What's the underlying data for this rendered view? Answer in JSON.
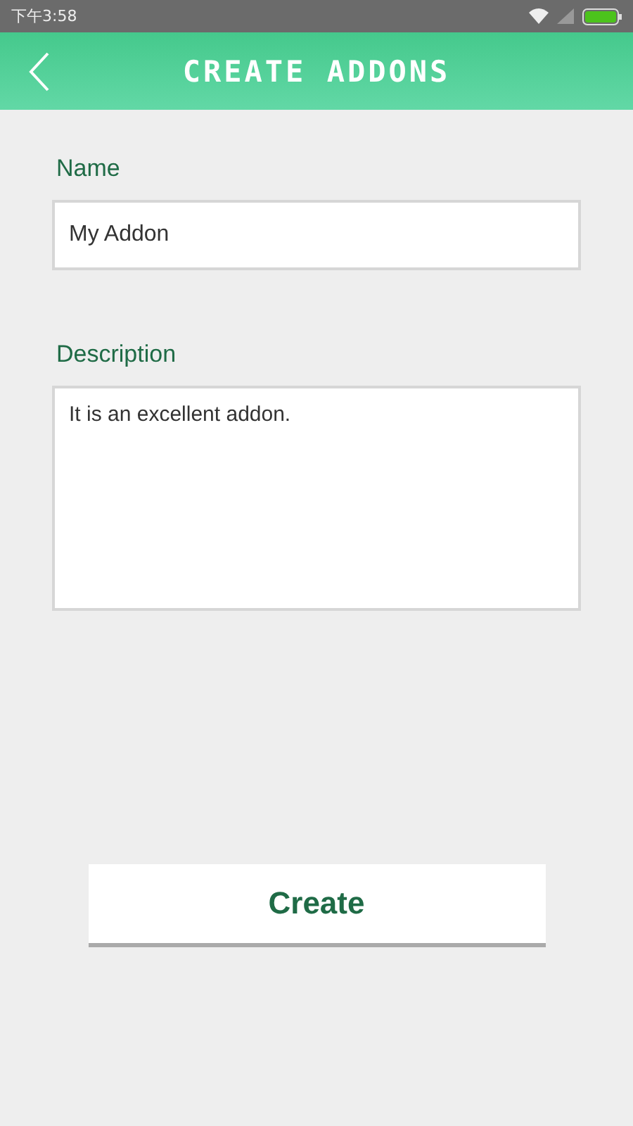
{
  "status_bar": {
    "time": "下午3:58"
  },
  "header": {
    "title": "CREATE ADDONS"
  },
  "fields": [
    {
      "kind": "input",
      "label": "Name",
      "value": "My Addon"
    },
    {
      "kind": "textarea",
      "label": "Description",
      "value": "It is an excellent addon."
    }
  ],
  "button": {
    "label": "Create"
  }
}
